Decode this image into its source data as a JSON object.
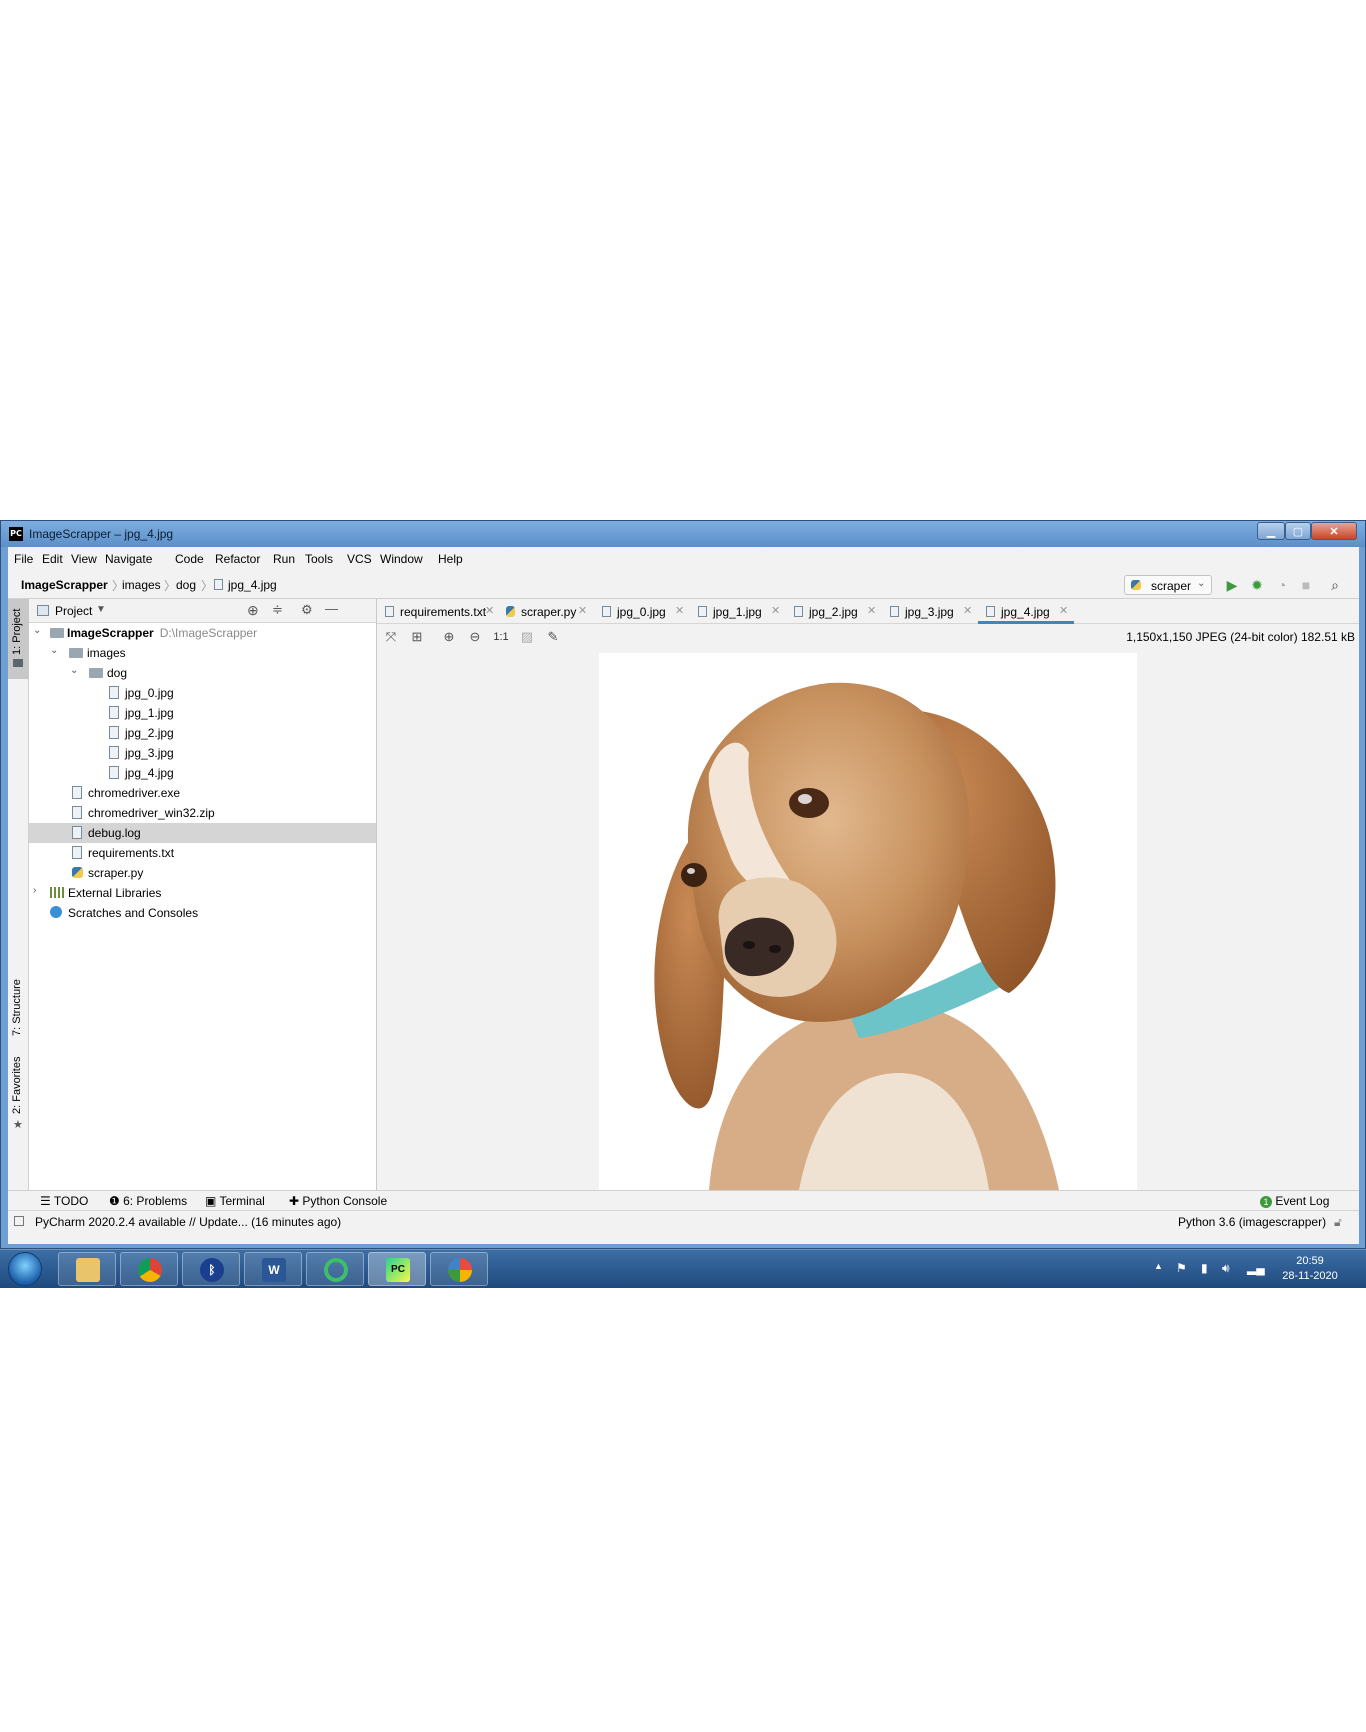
{
  "window": {
    "title": "ImageScrapper – jpg_4.jpg",
    "app_logo": "PC"
  },
  "menu": [
    "File",
    "Edit",
    "View",
    "Navigate",
    "Code",
    "Refactor",
    "Run",
    "Tools",
    "VCS",
    "Window",
    "Help"
  ],
  "breadcrumb": [
    "ImageScrapper",
    "images",
    "dog",
    "jpg_4.jpg"
  ],
  "run_config": {
    "label": "scraper"
  },
  "left_strip": {
    "project": "1: Project",
    "structure": "7: Structure",
    "favorites": "2: Favorites"
  },
  "project_panel": {
    "title": "Project",
    "tree": [
      {
        "label": "ImageScrapper",
        "path": "D:\\ImageScrapper",
        "type": "folder",
        "depth": 0,
        "expanded": true
      },
      {
        "label": "images",
        "type": "folder",
        "depth": 1,
        "expanded": true
      },
      {
        "label": "dog",
        "type": "folder",
        "depth": 2,
        "expanded": true
      },
      {
        "label": "jpg_0.jpg",
        "type": "image",
        "depth": 3
      },
      {
        "label": "jpg_1.jpg",
        "type": "image",
        "depth": 3
      },
      {
        "label": "jpg_2.jpg",
        "type": "image",
        "depth": 3
      },
      {
        "label": "jpg_3.jpg",
        "type": "image",
        "depth": 3
      },
      {
        "label": "jpg_4.jpg",
        "type": "image",
        "depth": 3
      },
      {
        "label": "chromedriver.exe",
        "type": "exe",
        "depth": 1
      },
      {
        "label": "chromedriver_win32.zip",
        "type": "zip",
        "depth": 1
      },
      {
        "label": "debug.log",
        "type": "log",
        "depth": 1,
        "selected": true
      },
      {
        "label": "requirements.txt",
        "type": "text",
        "depth": 1
      },
      {
        "label": "scraper.py",
        "type": "python",
        "depth": 1
      },
      {
        "label": "External Libraries",
        "type": "library",
        "depth": 0,
        "expanded": false
      },
      {
        "label": "Scratches and Consoles",
        "type": "scratch",
        "depth": 0
      }
    ]
  },
  "editor_tabs": [
    {
      "label": "requirements.txt",
      "active": false
    },
    {
      "label": "scraper.py",
      "active": false
    },
    {
      "label": "jpg_0.jpg",
      "active": false
    },
    {
      "label": "jpg_1.jpg",
      "active": false
    },
    {
      "label": "jpg_2.jpg",
      "active": false
    },
    {
      "label": "jpg_3.jpg",
      "active": false
    },
    {
      "label": "jpg_4.jpg",
      "active": true
    }
  ],
  "image_viewer": {
    "zoom_actual_label": "1:1",
    "info": "1,150x1,150 JPEG (24-bit color) 182.51 kB"
  },
  "tool_windows": {
    "todo": "TODO",
    "problems": "6: Problems",
    "terminal": "Terminal",
    "python_console": "Python Console",
    "event_log": "Event Log",
    "event_log_count": "1"
  },
  "status": {
    "message": "PyCharm 2020.2.4 available // Update... (16 minutes ago)",
    "interpreter": "Python 3.6 (imagescrapper)"
  },
  "taskbar": {
    "apps": [
      "file-explorer",
      "chrome",
      "bluetooth",
      "word",
      "refresh-app",
      "pycharm",
      "paint"
    ],
    "time": "20:59",
    "date": "28-11-2020"
  },
  "colors": {
    "accent": "#4083c9",
    "run_green": "#3c9a3c",
    "taskbar": "#2a5a93"
  }
}
